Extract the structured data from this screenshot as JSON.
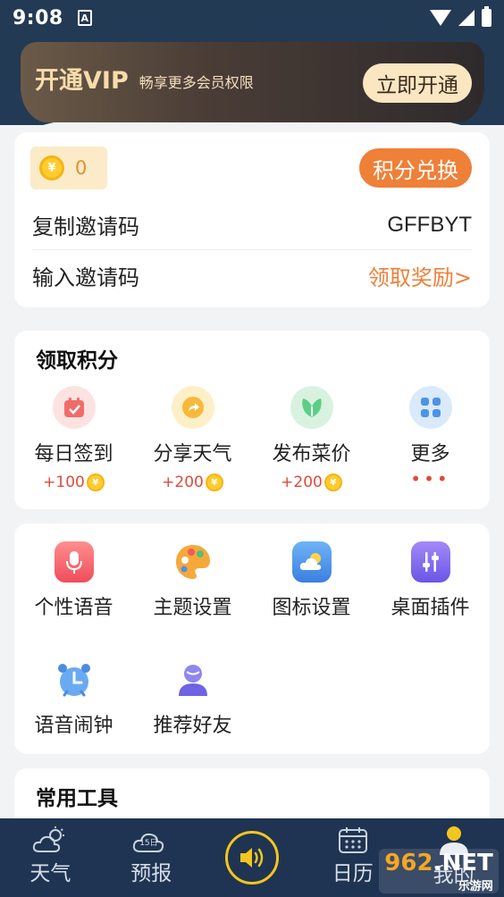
{
  "status": {
    "time": "9:08",
    "notify_icon": "A"
  },
  "vip": {
    "title": "开通VIP",
    "subtitle": "畅享更多会员权限",
    "button": "立即开通"
  },
  "invite": {
    "coin_symbol": "¥",
    "coins": "0",
    "exchange_button": "积分兑换",
    "copy_label": "复制邀请码",
    "code": "GFFBYT",
    "input_label": "输入邀请码",
    "claim_link": "领取奖励>"
  },
  "points": {
    "title": "领取积分",
    "tasks": [
      {
        "label": "每日签到",
        "reward": "+100"
      },
      {
        "label": "分享天气",
        "reward": "+200"
      },
      {
        "label": "发布菜价",
        "reward": "+200"
      },
      {
        "label": "更多",
        "reward": "•••"
      }
    ]
  },
  "features": [
    {
      "label": "个性语音"
    },
    {
      "label": "主题设置"
    },
    {
      "label": "图标设置"
    },
    {
      "label": "桌面插件"
    },
    {
      "label": "语音闹钟"
    },
    {
      "label": "推荐好友"
    }
  ],
  "tools": {
    "title": "常用工具"
  },
  "tabs": [
    {
      "label": "天气"
    },
    {
      "label": "预报",
      "badge": "15日"
    },
    {
      "label": ""
    },
    {
      "label": "日历"
    },
    {
      "label": "我的"
    }
  ],
  "watermark": {
    "num": "962",
    "suffix": ".NET",
    "sub": "乐游网"
  },
  "colors": {
    "accent": "#ee8038",
    "navy": "#1f3452",
    "gold": "#f3c51f"
  }
}
